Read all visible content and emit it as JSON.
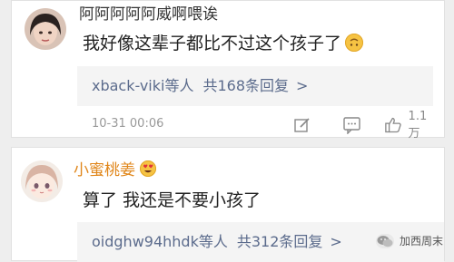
{
  "comments": [
    {
      "username": "阿阿阿阿阿威啊喂诶",
      "username_color": "#333333",
      "content": "我好像这辈子都比不过这个孩子了",
      "content_emoji": "upside-down-face-emoji",
      "replies": {
        "who": "xback-viki等人",
        "count": "共168条回复",
        "arrow": ">",
        "color": "#5b6b8c"
      },
      "timestamp": "10-31 00:06",
      "likes": "1.1万",
      "actions": [
        "edit-icon",
        "comment-icon",
        "like-icon"
      ]
    },
    {
      "username": "小蜜桃姜",
      "username_color": "#e0861a",
      "username_emoji": "heart-eyes-emoji",
      "content": "算了 我还是不要小孩了",
      "replies": {
        "who": "oidghw94hhdk等人",
        "count": "共312条回复",
        "arrow": ">",
        "color": "#5b6b8c"
      }
    }
  ],
  "watermark": {
    "text": "加西周末",
    "icon": "wechat-logo-icon"
  }
}
